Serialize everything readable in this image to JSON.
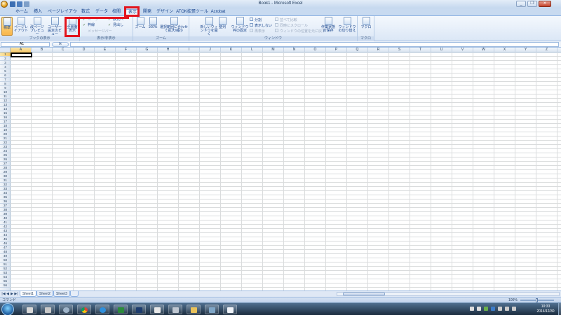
{
  "window": {
    "title": "Book1 - Microsoft Excel",
    "minimize_glyph": "_",
    "restore_glyph": "❐",
    "close_glyph": "✕"
  },
  "tabs": [
    {
      "label": "ホーム",
      "active": false
    },
    {
      "label": "挿入",
      "active": false
    },
    {
      "label": "ページレイアウト",
      "active": false
    },
    {
      "label": "数式",
      "active": false
    },
    {
      "label": "データ",
      "active": false
    },
    {
      "label": "校閲",
      "active": false
    },
    {
      "label": "表示",
      "active": true
    },
    {
      "label": "開発",
      "active": false
    },
    {
      "label": "デザイン",
      "active": false
    },
    {
      "label": "ATOK拡張ツール",
      "active": false
    },
    {
      "label": "Acrobat",
      "active": false
    }
  ],
  "ribbon": {
    "book_view": {
      "label": "ブックの表示",
      "normal": "標準",
      "page_layout": "ページレイアウト",
      "page_break_preview": "改ページプレビュー",
      "custom_views": "ユーザー設定のビュー",
      "full_screen": "全画面表示"
    },
    "show_hide": {
      "label": "表示/非表示",
      "ruler": "ルーラー",
      "gridlines": "枠線",
      "message_bar": "メッセージバー",
      "formula_bar": "数式バー",
      "headings": "見出し"
    },
    "zoom": {
      "label": "ズーム",
      "zoom": "ズーム",
      "hundred": "100%",
      "zoom_selection": "選択範囲に合わせて拡大/縮小"
    },
    "window": {
      "label": "ウィンドウ",
      "new_window": "新しいウィンドウを開く",
      "arrange_all": "整列",
      "freeze_panes": "ウィンドウ枠の固定",
      "split": "分割",
      "hide": "表示しない",
      "unhide": "再表示",
      "side_by_side": "並べて比較",
      "sync_scroll": "同時にスクロール",
      "reset_position": "ウィンドウの位置を元に戻す",
      "save_workspace": "作業状態の保存",
      "switch_windows": "ウィンドウの切り替え"
    },
    "macros": {
      "label": "マクロ",
      "macros": "マクロ"
    }
  },
  "formula_bar": {
    "name_box": "A1",
    "fx": "fx",
    "value": ""
  },
  "grid": {
    "columns": [
      "A",
      "B",
      "C",
      "D",
      "E",
      "F",
      "G",
      "H",
      "I",
      "J",
      "K",
      "L",
      "M",
      "N",
      "O",
      "P",
      "Q",
      "R",
      "S",
      "T",
      "U",
      "V",
      "W",
      "X",
      "Y",
      "Z"
    ],
    "row_count": 56,
    "active_cell": "A1"
  },
  "sheets": [
    {
      "label": "Sheet1",
      "active": true
    },
    {
      "label": "Sheet2",
      "active": false
    },
    {
      "label": "Sheet3",
      "active": false
    }
  ],
  "status_bar": {
    "mode": "コマンド",
    "zoom": "100%"
  },
  "taskbar": {
    "apps": [
      "explorer",
      "media",
      "chrome",
      "ie",
      "excel",
      "photoshop",
      "app7",
      "app8",
      "folder",
      "app10",
      "word"
    ],
    "clock_time": "10:33",
    "clock_date": "2014/12/30"
  },
  "colors": {
    "highlight_red": "#e2141d",
    "ribbon_accent": "#15428b",
    "selected_button": "#f8b54a"
  }
}
